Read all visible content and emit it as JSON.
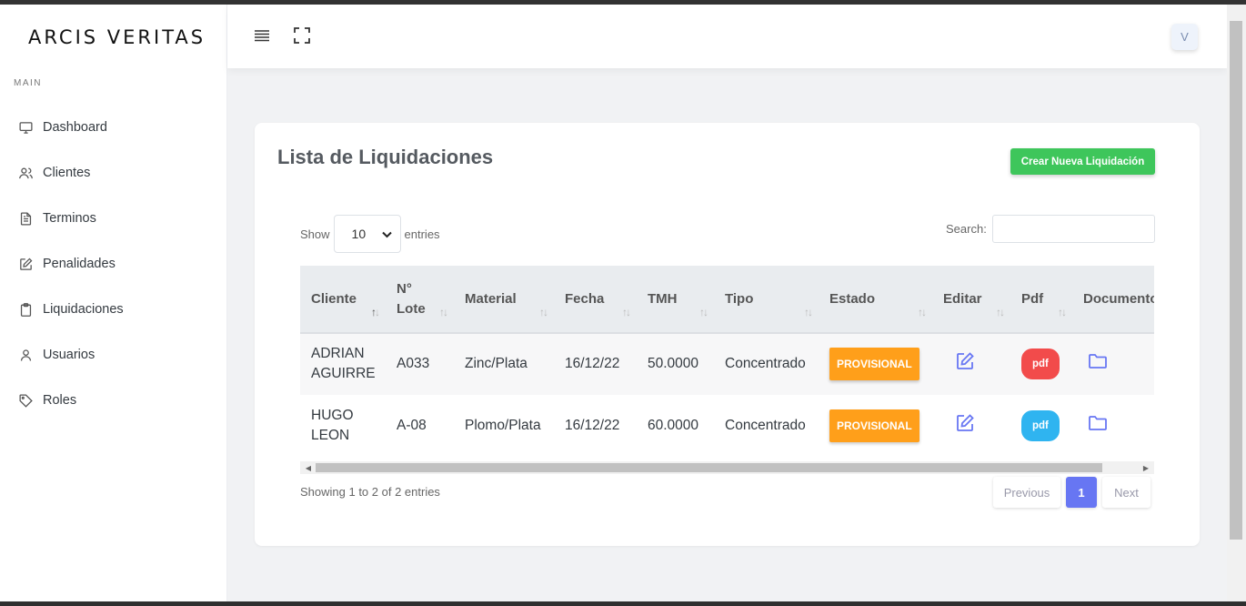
{
  "brand": "ARCIS VERITAS",
  "menu_heading": "MAIN",
  "nav": [
    {
      "label": "Dashboard",
      "icon": "monitor-icon"
    },
    {
      "label": "Clientes",
      "icon": "users-icon"
    },
    {
      "label": "Terminos",
      "icon": "file-text-icon"
    },
    {
      "label": "Penalidades",
      "icon": "edit-icon"
    },
    {
      "label": "Liquidaciones",
      "icon": "clipboard-icon"
    },
    {
      "label": "Usuarios",
      "icon": "user-icon"
    },
    {
      "label": "Roles",
      "icon": "tag-icon"
    }
  ],
  "header": {
    "menu_icon": "menu-icon",
    "fullscreen_icon": "fullscreen-icon",
    "avatar_initial": "V"
  },
  "card": {
    "title": "Lista de Liquidaciones",
    "create_button": "Crear Nueva Liquidación"
  },
  "length": {
    "show": "Show",
    "value": "10",
    "entries": "entries"
  },
  "search": {
    "label": "Search:",
    "value": ""
  },
  "table": {
    "columns": [
      "Cliente",
      "N° Lote",
      "Material",
      "Fecha",
      "TMH",
      "Tipo",
      "Estado",
      "Editar",
      "Pdf",
      "Documento"
    ],
    "rows": [
      {
        "cliente": "ADRIAN AGUIRRE",
        "lote": "A033",
        "material": "Zinc/Plata",
        "fecha": "16/12/22",
        "tmh": "50.0000",
        "tipo": "Concentrado",
        "estado": "PROVISIONAL",
        "pdf": "pdf",
        "pdf_color": "#f24b4b"
      },
      {
        "cliente": "HUGO LEON",
        "lote": "A-08",
        "material": "Plomo/Plata",
        "fecha": "16/12/22",
        "tmh": "60.0000",
        "tipo": "Concentrado",
        "estado": "PROVISIONAL",
        "pdf": "pdf",
        "pdf_color": "#2fb4f0"
      }
    ]
  },
  "footer": {
    "info": "Showing 1 to 2 of 2 entries",
    "previous": "Previous",
    "page": "1",
    "next": "Next"
  },
  "colors": {
    "accent": "#6776f3",
    "create": "#3ec65b",
    "status": "#ff9f1a"
  }
}
